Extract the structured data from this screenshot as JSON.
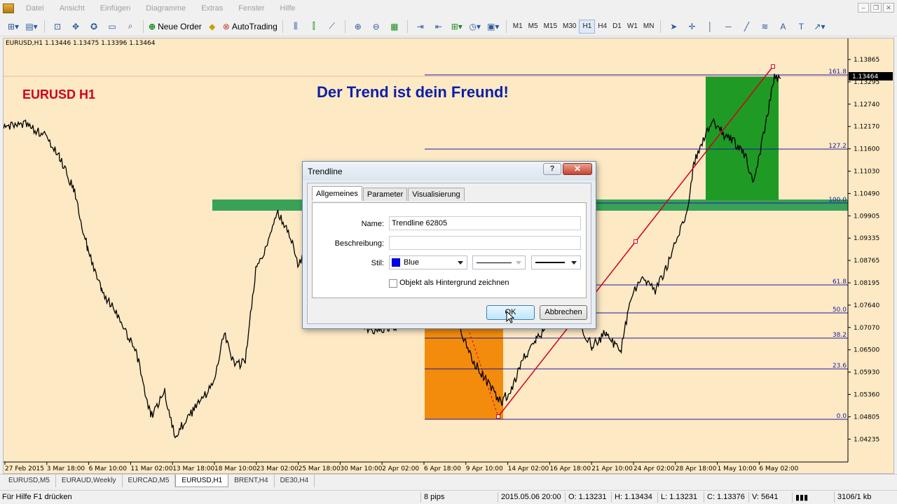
{
  "menubar": {
    "items": [
      "Datei",
      "Ansicht",
      "Einfügen",
      "Diagramme",
      "Extras",
      "Fenster",
      "Hilfe"
    ]
  },
  "toolbar": {
    "new_order_label": "Neue Order",
    "autotrading_label": "AutoTrading",
    "timeframes": [
      "M1",
      "M5",
      "M15",
      "M30",
      "H1",
      "H4",
      "D1",
      "W1",
      "MN"
    ],
    "active_timeframe": "H1"
  },
  "chart": {
    "header": "EURUSD,H1  1.13446 1.13475 1.13396 1.13464",
    "symbol_label": "EURUSD H1",
    "headline": "Der Trend ist dein Freund!",
    "price_labels": [
      "1.13865",
      "1.13464",
      "1.13295",
      "1.12740",
      "1.12170",
      "1.11600",
      "1.11030",
      "1.10490",
      "1.09905",
      "1.09335",
      "1.08765",
      "1.08195",
      "1.07640",
      "1.07070",
      "1.06500",
      "1.05930",
      "1.05360",
      "1.04805",
      "1.04235"
    ],
    "current_price": "1.13464",
    "fib_levels": [
      "161.8",
      "127.2",
      "100.0",
      "61.8",
      "50.0",
      "38.2",
      "23.6",
      "0.0"
    ],
    "time_labels": [
      "27 Feb 2015",
      "3 Mar 18:00",
      "6 Mar 10:00",
      "11 Mar 02:00",
      "13 Mar 18:00",
      "18 Mar 10:00",
      "23 Mar 02:00",
      "25 Mar 18:00",
      "30 Mar 10:00",
      "2 Apr 02:00",
      "6 Apr 18:00",
      "9 Apr 10:00",
      "14 Apr 02:00",
      "16 Apr 18:00",
      "21 Apr 10:00",
      "24 Apr 02:00",
      "28 Apr 18:00",
      "1 May 10:00",
      "6 May 02:00"
    ],
    "colors": {
      "background": "#fde9c4",
      "price_line": "#000000",
      "trendline": "#d0021b",
      "fib_line": "#1a1aa0",
      "support_zone": "#2e9e52",
      "target_zone": "#1f9a25",
      "entry_zone": "#f38b0c"
    }
  },
  "tabs": {
    "items": [
      "EURUSD,M5",
      "EURAUD,Weekly",
      "EURCAD,M5",
      "EURUSD,H1",
      "BRENT,H4",
      "DE30,H4"
    ],
    "active": "EURUSD,H1"
  },
  "statusbar": {
    "help": "Für Hilfe F1 drücken",
    "pips": "8 pips",
    "datetime": "2015.05.06 20:00",
    "open": "O: 1.13231",
    "high": "H: 1.13434",
    "low": "L: 1.13231",
    "close": "C: 1.13376",
    "volume": "V: 5641",
    "traffic": "3106/1 kb"
  },
  "dialog": {
    "title": "Trendline",
    "help_glyph": "?",
    "close_glyph": "✕",
    "tabs": [
      "Allgemeines",
      "Parameter",
      "Visualisierung"
    ],
    "active_tab": "Allgemeines",
    "name_label": "Name:",
    "name_value": "Trendline 62805",
    "description_label": "Beschreibung:",
    "description_value": "",
    "style_label": "Stil:",
    "color_value": "Blue",
    "color_hex": "#0000ff",
    "background_checkbox_label": "Objekt als Hintergrund zeichnen",
    "background_checked": false,
    "ok_label": "OK",
    "cancel_label": "Abbrechen"
  }
}
